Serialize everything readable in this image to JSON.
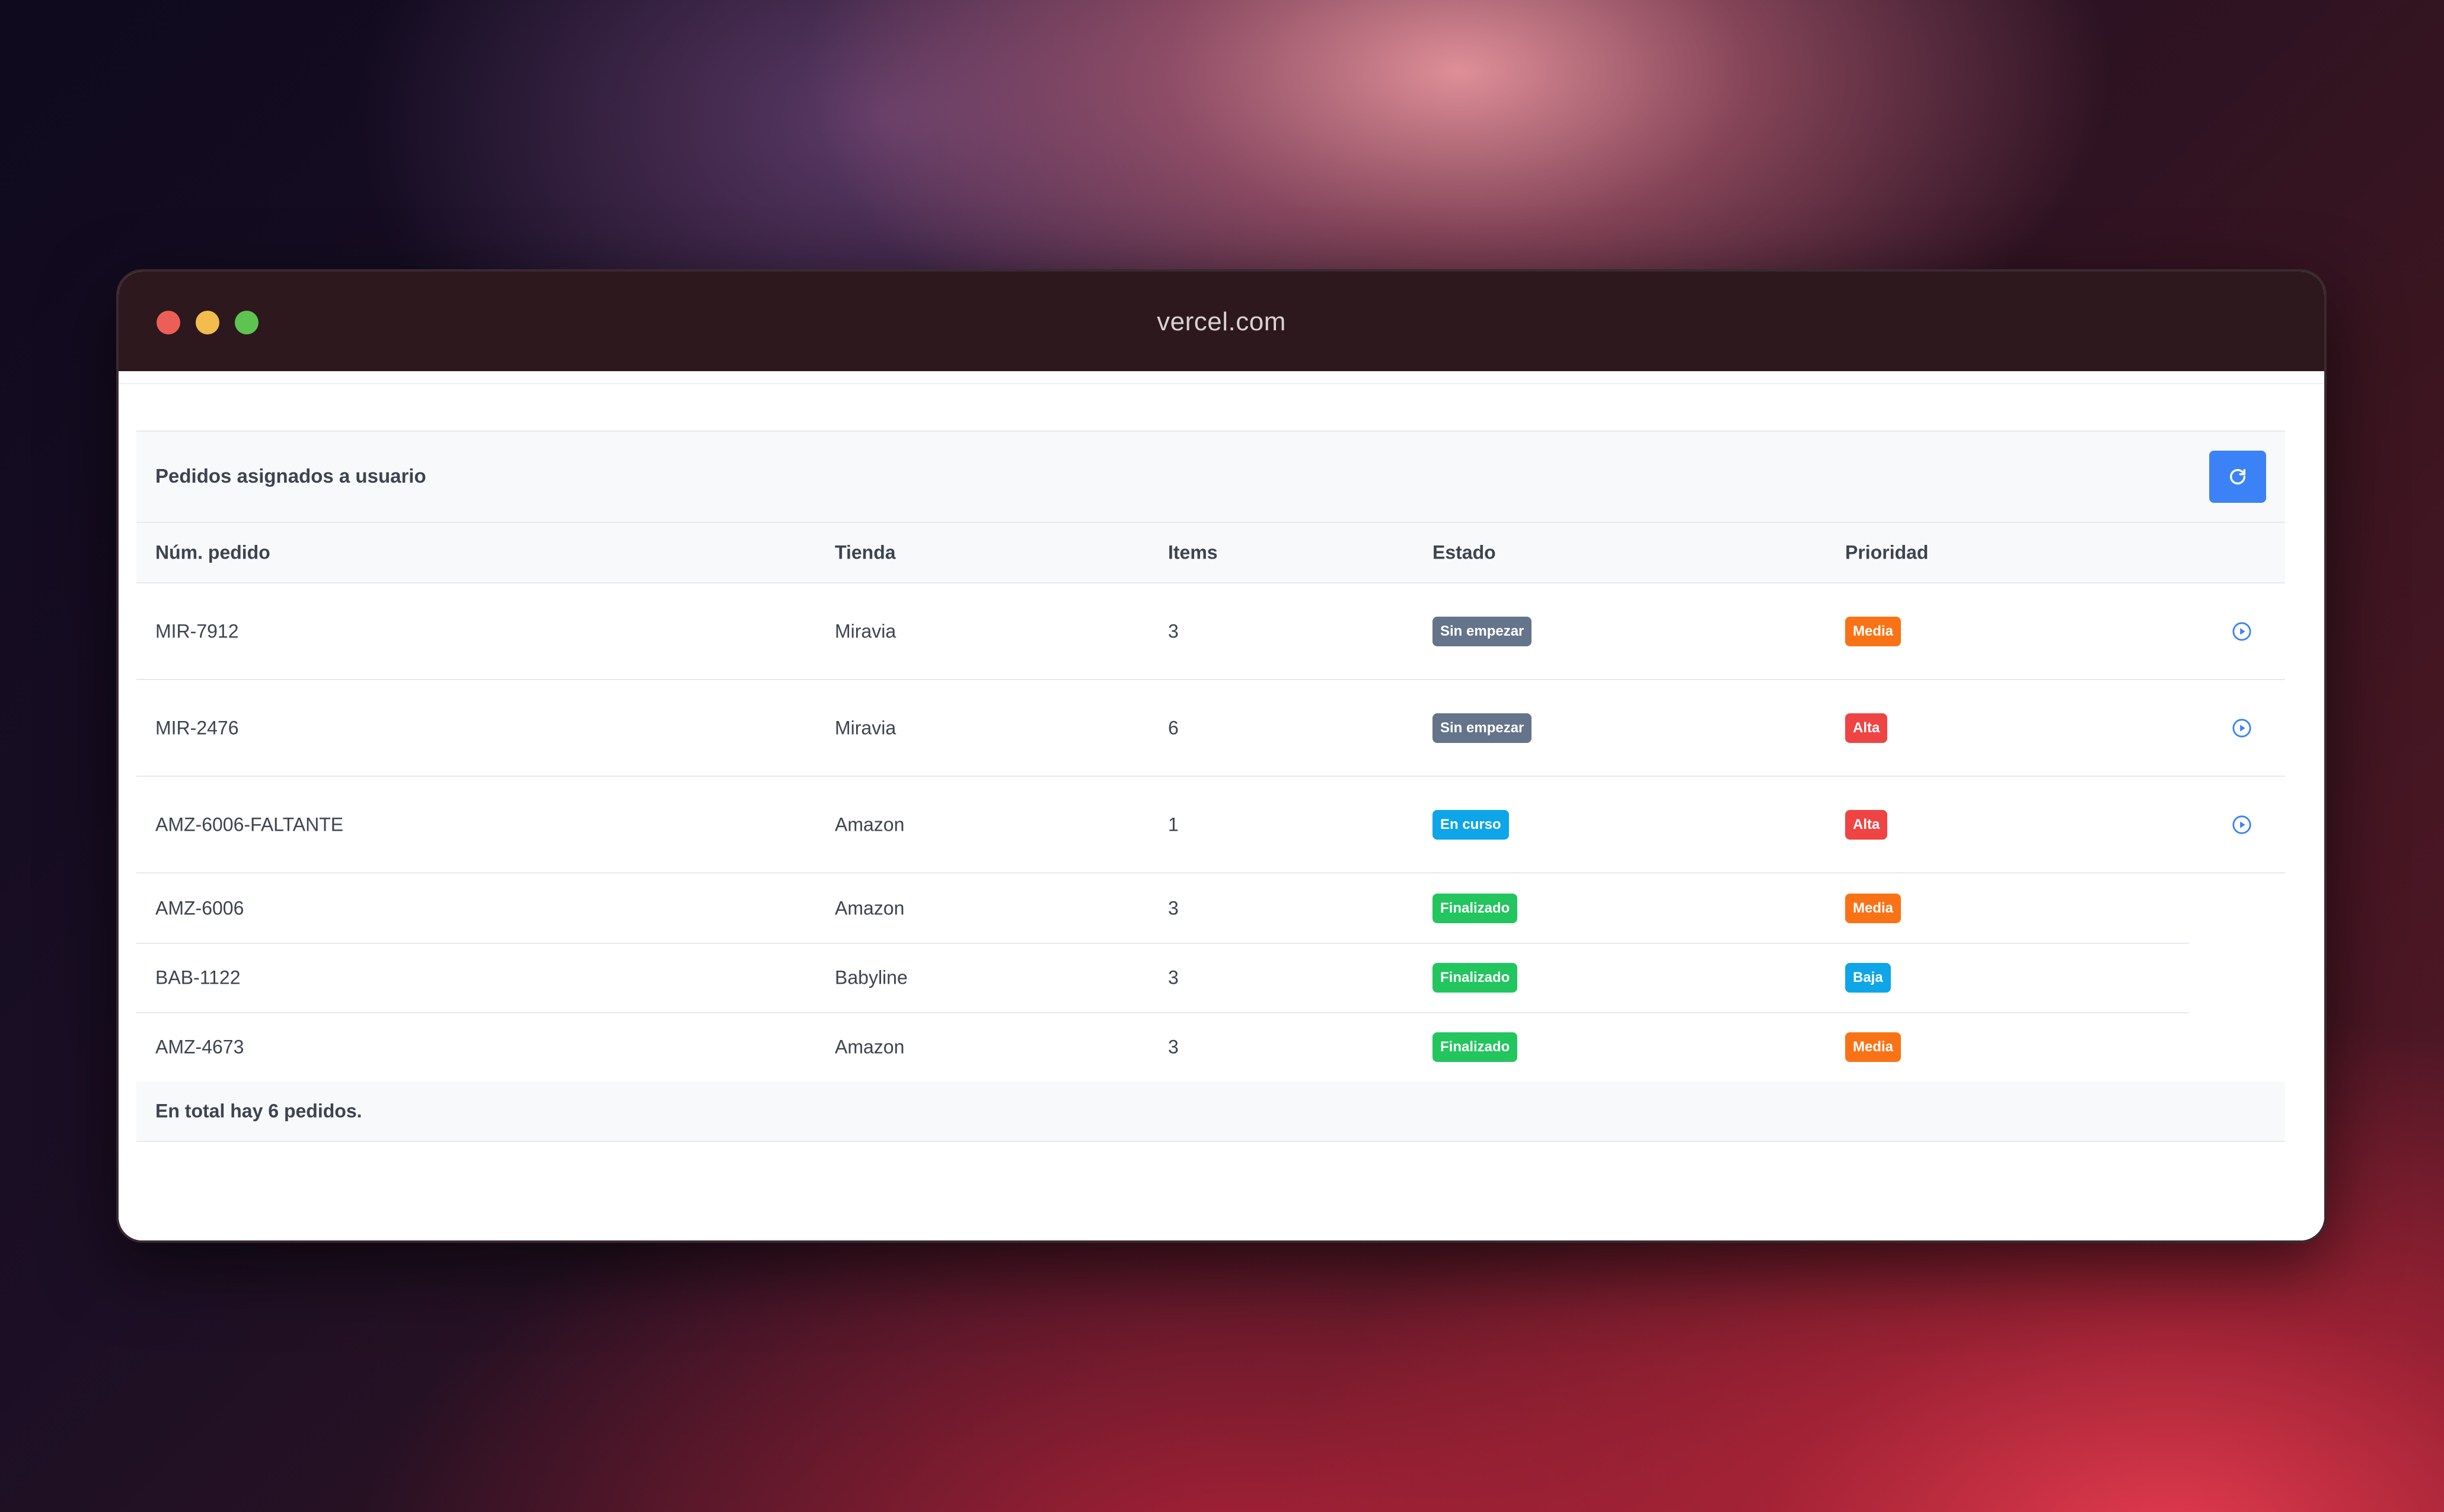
{
  "browser": {
    "url": "vercel.com"
  },
  "panel": {
    "title": "Pedidos asignados a usuario",
    "refresh_icon": "refresh-icon"
  },
  "table": {
    "headers": [
      "Núm. pedido",
      "Tienda",
      "Items",
      "Estado",
      "Prioridad"
    ],
    "rows": [
      {
        "order": "MIR-7912",
        "store": "Miravia",
        "items": "3",
        "status": "Sin empezar",
        "priority": "Media",
        "action": "play-circle-icon"
      },
      {
        "order": "MIR-2476",
        "store": "Miravia",
        "items": "6",
        "status": "Sin empezar",
        "priority": "Alta",
        "action": "play-circle-icon"
      },
      {
        "order": "AMZ-6006-FALTANTE",
        "store": "Amazon",
        "items": "1",
        "status": "En curso",
        "priority": "Alta",
        "action": "play-circle-icon"
      },
      {
        "order": "AMZ-6006",
        "store": "Amazon",
        "items": "3",
        "status": "Finalizado",
        "priority": "Media"
      },
      {
        "order": "BAB-1122",
        "store": "Babyline",
        "items": "3",
        "status": "Finalizado",
        "priority": "Baja"
      },
      {
        "order": "AMZ-4673",
        "store": "Amazon",
        "items": "3",
        "status": "Finalizado",
        "priority": "Media"
      }
    ],
    "footer": "En total hay 6 pedidos."
  },
  "colors": {
    "status": {
      "Sin empezar": "#64748b",
      "En curso": "#0ea5e9",
      "Finalizado": "#22c55e"
    },
    "priority": {
      "Media": "#f97316",
      "Alta": "#ef4444",
      "Baja": "#0ea5e9"
    },
    "accent": "#3b82f6"
  }
}
